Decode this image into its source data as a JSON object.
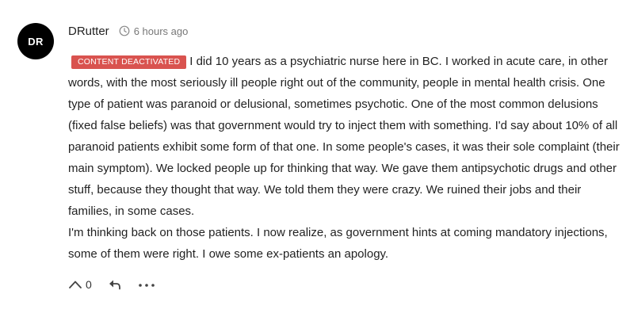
{
  "comment": {
    "avatar_initials": "DR",
    "author": "DRutter",
    "timestamp": "6 hours ago",
    "badge": "CONTENT DEACTIVATED",
    "body_first": "I did 10 years as a psychiatric nurse here in BC. I worked in acute care, in other words, with the most seriously ill people right out of the community, people in mental health crisis. One type of patient was paranoid or delusional, sometimes psychotic. One of the most common delusions (fixed false beliefs) was that government would try to inject them with something. I'd say about 10% of all paranoid patients exhibit some form of that one. In some people's cases, it was their sole complaint (their main symptom). We locked people up for thinking that way. We gave them antipsychotic drugs and other stuff, because they thought that way. We told them they were crazy. We ruined their jobs and their families, in some cases.",
    "body_second": "I'm thinking back on those patients. I now realize, as government hints at coming mandatory injections, some of them were right. I owe some ex-patients an apology.",
    "vote_count": "0"
  },
  "icons": {
    "clock": "clock-icon",
    "upvote": "chevron-up-icon",
    "reply": "reply-arrow-icon",
    "more": "more-dots-icon"
  },
  "colors": {
    "badge_bg": "#d9534f",
    "avatar_bg": "#000000",
    "meta_text": "#777777"
  }
}
